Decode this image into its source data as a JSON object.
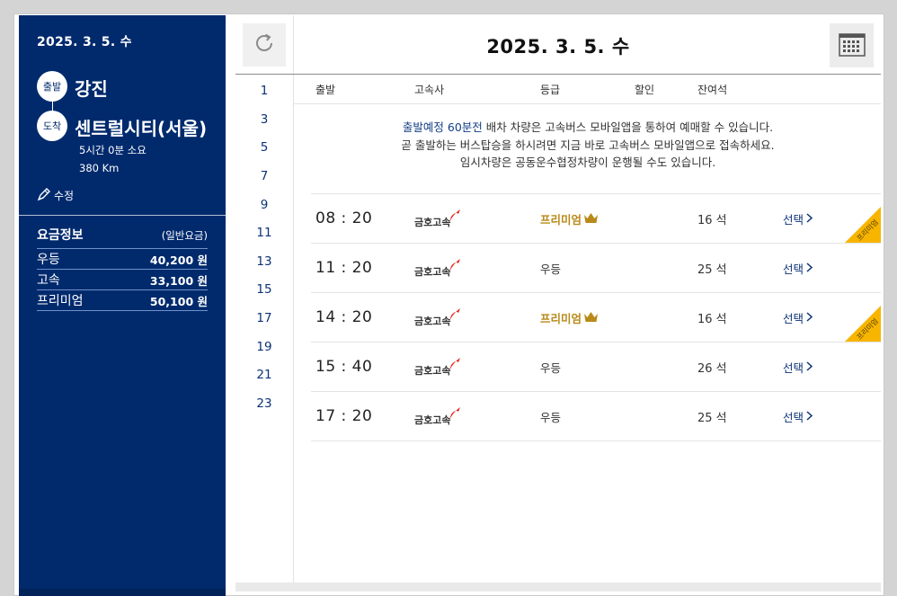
{
  "sidebar": {
    "date": "2025. 3. 5. 수",
    "departure_label": "출발",
    "departure_place": "강진",
    "arrival_label": "도착",
    "arrival_place": "센트럴시티(서울)",
    "duration": "5시간 0분 소요",
    "distance": "380 Km",
    "edit_label": "수정",
    "fare_title": "요금정보",
    "fare_subtitle": "(일반요금)",
    "fares": [
      {
        "grade": "우등",
        "amount": "40,200 원"
      },
      {
        "grade": "고속",
        "amount": "33,100 원"
      },
      {
        "grade": "프리미엄",
        "amount": "50,100 원"
      }
    ],
    "icons": {
      "edit": "pencil-icon"
    }
  },
  "main": {
    "date": "2025. 3. 5. 수",
    "icons": {
      "refresh": "refresh-icon",
      "calendar": "calendar-icon"
    },
    "hours": [
      "1",
      "3",
      "5",
      "7",
      "9",
      "11",
      "13",
      "15",
      "17",
      "19",
      "21",
      "23"
    ],
    "columns": {
      "departure": "출발",
      "company": "고속사",
      "grade": "등급",
      "discount": "할인",
      "seats": "잔여석"
    },
    "notice": {
      "highlight": "출발예정 60분전",
      "line1_rest": " 배차 차량은 고속버스 모바일앱을 통하여 예매할 수 있습니다.",
      "line2": "곧 출발하는 버스탑승을 하시려면 지금 바로 고속버스 모바일앱으로 접속하세요.",
      "line3": "임시차량은 공동운수협정차량이 운행될 수도 있습니다."
    },
    "schedules": [
      {
        "time": "08 : 20",
        "company": "금호고속",
        "grade": "프리미엄",
        "premium": true,
        "seats": "16 석",
        "select": "선택",
        "ribbon": "프리미엄"
      },
      {
        "time": "11 : 20",
        "company": "금호고속",
        "grade": "우등",
        "premium": false,
        "seats": "25 석",
        "select": "선택"
      },
      {
        "time": "14 : 20",
        "company": "금호고속",
        "grade": "프리미엄",
        "premium": true,
        "seats": "16 석",
        "select": "선택",
        "ribbon": "프리미엄"
      },
      {
        "time": "15 : 40",
        "company": "금호고속",
        "grade": "우등",
        "premium": false,
        "seats": "26 석",
        "select": "선택"
      },
      {
        "time": "17 : 20",
        "company": "금호고속",
        "grade": "우등",
        "premium": false,
        "seats": "25 석",
        "select": "선택"
      }
    ]
  },
  "colors": {
    "sidebar_bg": "#012a6d",
    "premium_gold": "#b98a1a",
    "link_blue": "#0c3276",
    "ribbon": "#f7b500",
    "logo_red": "#e2231a"
  }
}
